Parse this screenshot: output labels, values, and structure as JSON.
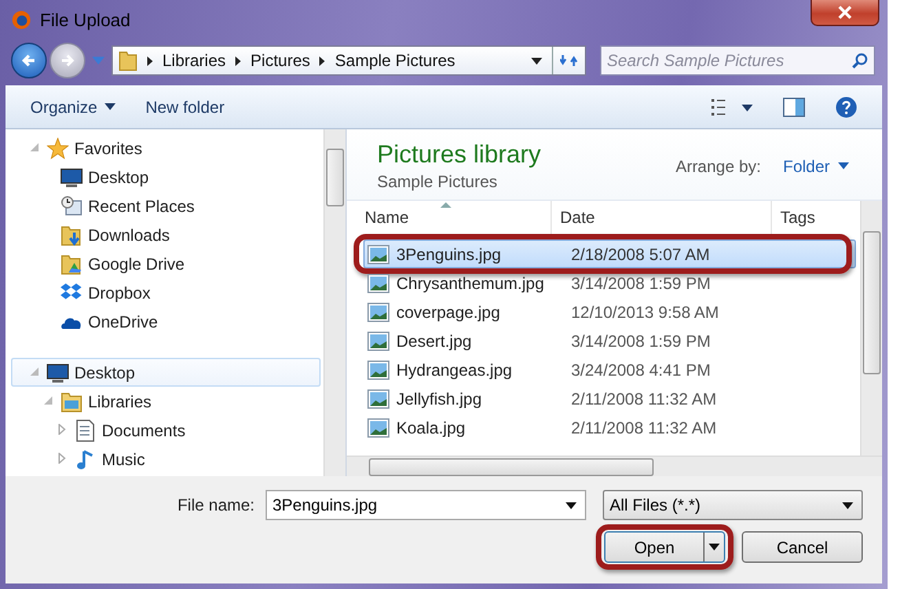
{
  "window": {
    "title": "File Upload"
  },
  "address_bar": {
    "breadcrumbs": [
      "Libraries",
      "Pictures",
      "Sample Pictures"
    ]
  },
  "search": {
    "placeholder": "Search Sample Pictures"
  },
  "toolbar": {
    "organize": "Organize",
    "new_folder": "New folder"
  },
  "nav": {
    "tree": [
      {
        "label": "Favorites",
        "expanded": true,
        "selected": false,
        "children": [
          {
            "label": "Desktop",
            "selected": false
          },
          {
            "label": "Recent Places",
            "selected": false
          },
          {
            "label": "Downloads",
            "selected": false
          },
          {
            "label": "Google Drive",
            "selected": false
          },
          {
            "label": "Dropbox",
            "selected": false
          },
          {
            "label": "OneDrive",
            "selected": false
          }
        ]
      },
      {
        "label": "Desktop",
        "expanded": true,
        "selected": true,
        "children": [
          {
            "label": "Libraries",
            "expanded": true,
            "selected": false,
            "children": [
              {
                "label": "Documents",
                "expanded": false,
                "selected": false
              },
              {
                "label": "Music",
                "expanded": false,
                "selected": false
              }
            ]
          }
        ]
      }
    ]
  },
  "library": {
    "title": "Pictures library",
    "subtitle": "Sample Pictures",
    "arrange_label": "Arrange by:",
    "arrange_value": "Folder"
  },
  "files": {
    "columns": [
      "Name",
      "Date",
      "Tags"
    ],
    "rows": [
      {
        "name": "3Penguins.jpg",
        "date": "2/18/2008 5:07 AM",
        "selected": true,
        "highlighted": true
      },
      {
        "name": "Chrysanthemum.jpg",
        "date": "3/14/2008 1:59 PM",
        "selected": false,
        "highlighted": false
      },
      {
        "name": "coverpage.jpg",
        "date": "12/10/2013 9:58 AM",
        "selected": false,
        "highlighted": false
      },
      {
        "name": "Desert.jpg",
        "date": "3/14/2008 1:59 PM",
        "selected": false,
        "highlighted": false
      },
      {
        "name": "Hydrangeas.jpg",
        "date": "3/24/2008 4:41 PM",
        "selected": false,
        "highlighted": false
      },
      {
        "name": "Jellyfish.jpg",
        "date": "2/11/2008 11:32 AM",
        "selected": false,
        "highlighted": false
      },
      {
        "name": "Koala.jpg",
        "date": "2/11/2008 11:32 AM",
        "selected": false,
        "highlighted": false
      }
    ]
  },
  "footer": {
    "file_name_label": "File name:",
    "file_name_value": "3Penguins.jpg",
    "filter": "All Files (*.*)",
    "buttons": [
      {
        "label": "Open",
        "kind": "split",
        "highlighted": true
      },
      {
        "label": "Cancel",
        "kind": "plain",
        "highlighted": false
      }
    ]
  }
}
